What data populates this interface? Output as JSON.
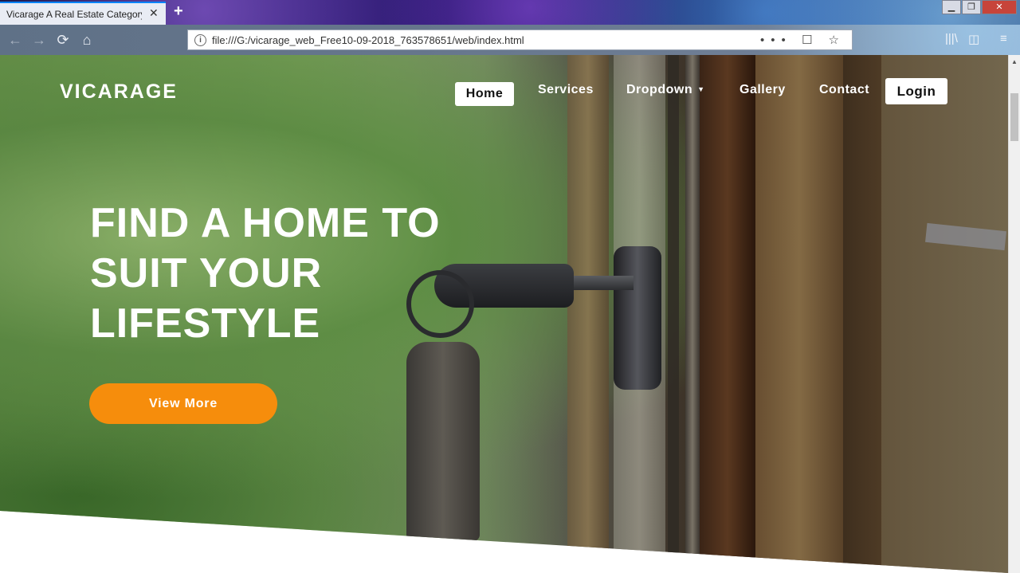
{
  "browser": {
    "tab_title": "Vicarage A Real Estate Category Bo",
    "tab_close": "✕",
    "new_tab": "+",
    "window_controls": {
      "minimize": "▁",
      "maximize": "❐",
      "close": "✕"
    },
    "url": "file:///G:/vicarage_web_Free10-09-2018_763578651/web/index.html",
    "url_info_icon": "i",
    "url_actions": "••• ☐ ☆",
    "nav_icons": {
      "back": "←",
      "forward": "→",
      "reload": "⟳",
      "home": "⌂"
    },
    "tools": {
      "library": "|||\\",
      "sidebar": "◫",
      "menu": "≡"
    }
  },
  "site": {
    "brand": "VICARAGE",
    "nav": {
      "home": "Home",
      "services": "Services",
      "dropdown": "Dropdown",
      "dropdown_caret": "▼",
      "gallery": "Gallery",
      "contact": "Contact",
      "login": "Login"
    },
    "hero": {
      "headline": "FIND A HOME TO SUIT YOUR LIFESTYLE",
      "cta": "View More"
    }
  },
  "colors": {
    "accent": "#f68d0c",
    "tab_highlight": "#0a84ff"
  }
}
